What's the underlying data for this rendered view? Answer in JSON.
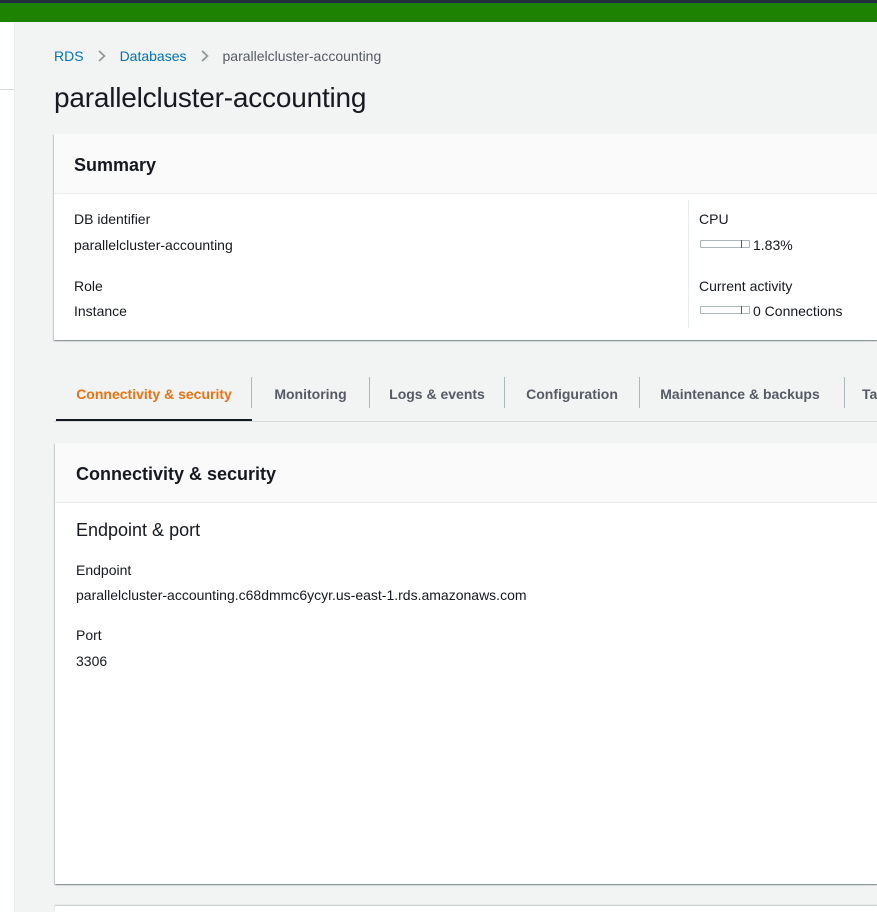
{
  "breadcrumb": {
    "items": [
      {
        "label": "RDS",
        "link": true
      },
      {
        "label": "Databases",
        "link": true
      },
      {
        "label": "parallelcluster-accounting",
        "link": false
      }
    ]
  },
  "page": {
    "title": "parallelcluster-accounting"
  },
  "summary": {
    "title": "Summary",
    "db_identifier_label": "DB identifier",
    "db_identifier_value": "parallelcluster-accounting",
    "role_label": "Role",
    "role_value": "Instance",
    "cpu_label": "CPU",
    "cpu_value": "1.83%",
    "cpu_fraction": 0.0183,
    "activity_label": "Current activity",
    "activity_value": "0 Connections",
    "activity_fraction": 0
  },
  "tabs": [
    {
      "label": "Connectivity & security",
      "active": true
    },
    {
      "label": "Monitoring",
      "active": false
    },
    {
      "label": "Logs & events",
      "active": false
    },
    {
      "label": "Configuration",
      "active": false
    },
    {
      "label": "Maintenance & backups",
      "active": false
    },
    {
      "label": "Ta",
      "active": false
    }
  ],
  "connectivity": {
    "title": "Connectivity & security",
    "section_title": "Endpoint & port",
    "endpoint_label": "Endpoint",
    "endpoint_value": "parallelcluster-accounting.c68dmmc6ycyr.us-east-1.rds.amazonaws.com",
    "port_label": "Port",
    "port_value": "3306"
  },
  "colors": {
    "top_banner": "#1d8102",
    "link": "#0073bb",
    "active_tab": "#ec7211",
    "bar_marker": "#d13212"
  }
}
